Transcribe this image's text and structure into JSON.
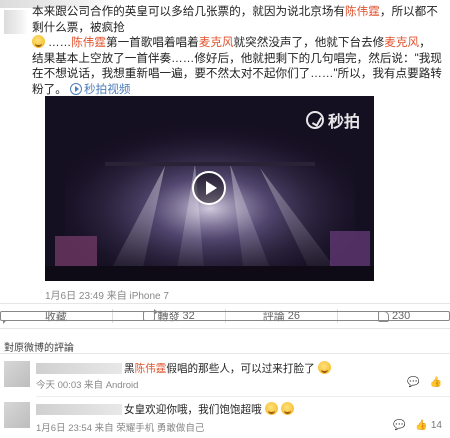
{
  "post": {
    "line1": "本来跟公司合作的英皇可以多给几张票的，就因为说北京场有",
    "name1": "陈伟霆",
    "line1b": "，所以都不剩什么票，被疯抢",
    "line2a": "……",
    "name2": "陈伟霆",
    "line2b": "第一首歌唱着唱着",
    "mic1": "麦克风",
    "line2c": "就突然没声了，他就下台去修",
    "mic2": "麦克风",
    "line2d": "，结果基本上空放了一首伴奏……修好后，他就把剩下的几句唱完，然后说：\"我现在不想说话，我想重新唱一遍，要不然太对不起你们了……\"所以，我有点要路转粉了。",
    "video_link": "秒拍视频"
  },
  "video": {
    "watermark": "秒拍"
  },
  "meta": {
    "timestamp_device": "1月6日 23:49 来自 iPhone 7"
  },
  "actions": {
    "favorite": "收藏",
    "repost": "轉發",
    "repost_count": "32",
    "comment": "評論",
    "comment_count": "26",
    "like_count": "230"
  },
  "comments_section": {
    "title": "對原微博的評論"
  },
  "comments": [
    {
      "text_a": "黑",
      "name": "陈伟霆",
      "text_b": "假唱的那些人，可以过来打脸了",
      "time": "今天 00:03 来自 Android",
      "like_count": ""
    },
    {
      "text_a": "女皇欢迎你哦，我们饱饱超哦",
      "time": "1月6日 23:54 来自 荣耀手机 勇敢做自己",
      "like_count": "14"
    }
  ],
  "colors": {
    "highlight": "#e0532d",
    "link": "#4d7dbb",
    "meta": "#888888"
  }
}
